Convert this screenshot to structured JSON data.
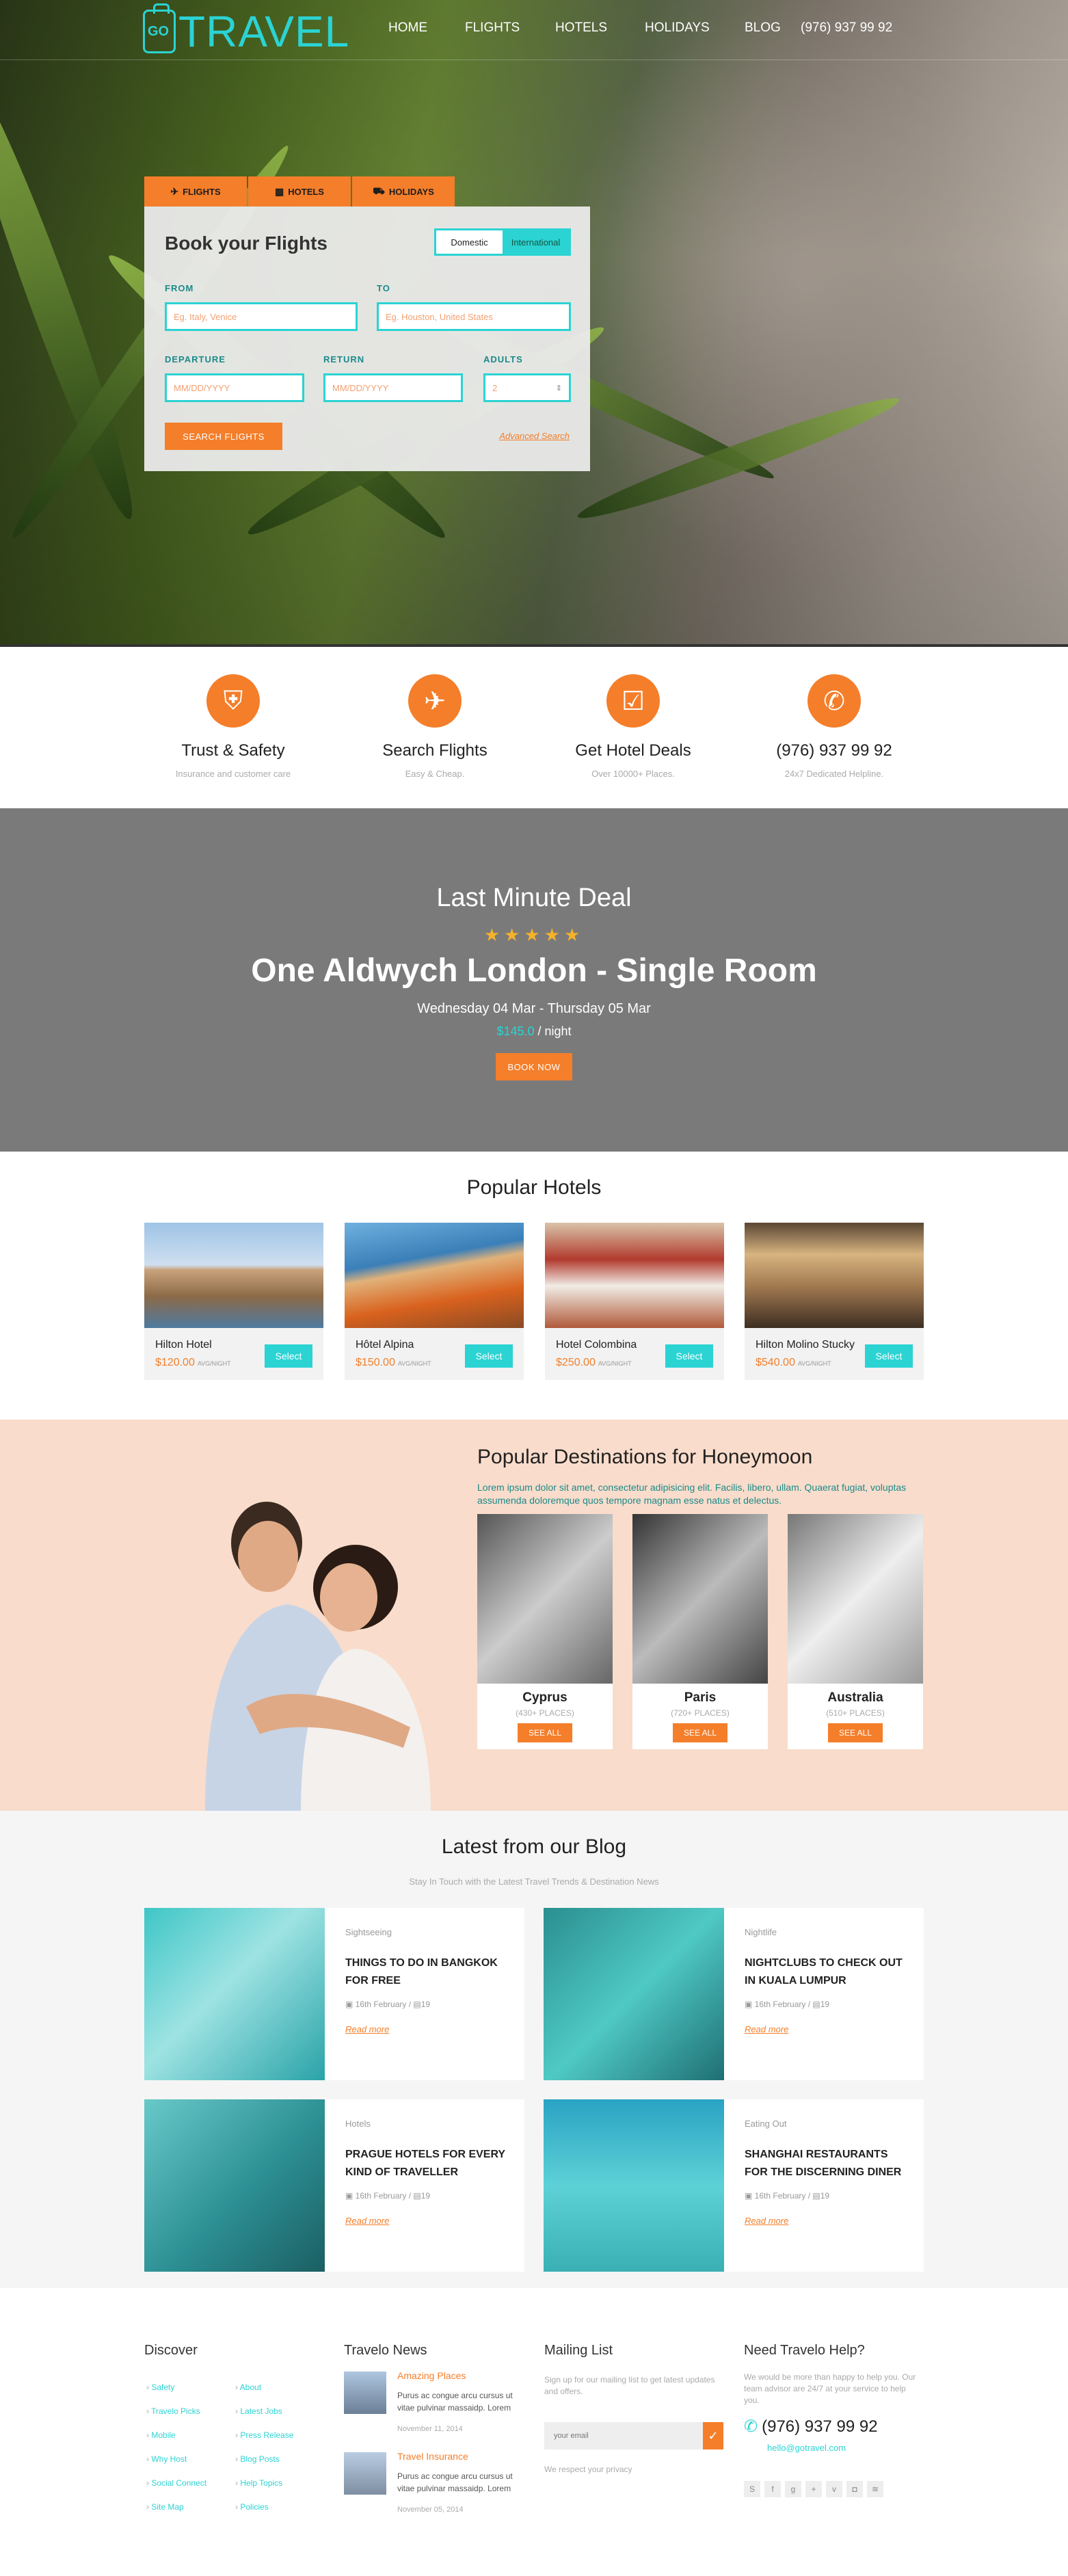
{
  "brand": {
    "logo_badge": "GO",
    "logo_text": "TRAVEL"
  },
  "nav": {
    "items": [
      "HOME",
      "FLIGHTS",
      "HOTELS",
      "HOLIDAYS",
      "BLOG",
      "(976) 937 99 92"
    ]
  },
  "search": {
    "tabs": [
      {
        "label": "FLIGHTS",
        "icon": "airplane-icon"
      },
      {
        "label": "HOTELS",
        "icon": "building-icon"
      },
      {
        "label": "HOLIDAYS",
        "icon": "suitcase-icon"
      }
    ],
    "title": "Book your Flights",
    "toggle": {
      "domestic": "Domestic",
      "international": "International"
    },
    "from_label": "FROM",
    "from_placeholder": "Eg. Italy, Venice",
    "to_label": "TO",
    "to_placeholder": "Eg. Houston, United States",
    "departure_label": "DEPARTURE",
    "departure_placeholder": "MM/DD/YYYY",
    "return_label": "RETURN",
    "return_placeholder": "MM/DD/YYYY",
    "adults_label": "ADULTS",
    "adults_value": "2",
    "submit": "SEARCH FLIGHTS",
    "advanced": "Advanced Search"
  },
  "features": [
    {
      "title": "Trust & Safety",
      "subtitle": "Insurance and customer care",
      "icon": "shield-icon"
    },
    {
      "title": "Search Flights",
      "subtitle": "Easy & Cheap.",
      "icon": "airplane-icon"
    },
    {
      "title": "Get Hotel Deals",
      "subtitle": "Over 10000+ Places.",
      "icon": "calendar-check-icon"
    },
    {
      "title": "(976) 937 99 92",
      "subtitle": "24x7 Dedicated Helpline.",
      "icon": "phone-icon"
    }
  ],
  "deal": {
    "heading": "Last Minute Deal",
    "stars": "★★★★★",
    "rating": 5,
    "title": "One Aldwych London - Single Room",
    "dates": "Wednesday 04 Mar - Thursday 05 Mar",
    "price": "$145.0",
    "per": " / night",
    "button": "BOOK NOW"
  },
  "hotels": {
    "title": "Popular Hotels",
    "per_night": "AVG/NIGHT",
    "select": "Select",
    "items": [
      {
        "name": "Hilton Hotel",
        "price": "$120.00"
      },
      {
        "name": "Hôtel Alpina",
        "price": "$150.00"
      },
      {
        "name": "Hotel Colombina",
        "price": "$250.00"
      },
      {
        "name": "Hilton Molino Stucky",
        "price": "$540.00"
      }
    ]
  },
  "honeymoon": {
    "title": "Popular Destinations for Honeymoon",
    "text": "Lorem ipsum dolor sit amet, consectetur adipisicing elit. Facilis, libero, ullam. Quaerat fugiat, voluptas assumenda doloremque quos tempore magnam esse natus et delectus.",
    "see_all": "SEE ALL",
    "items": [
      {
        "name": "Cyprus",
        "places": "(430+ PLACES)"
      },
      {
        "name": "Paris",
        "places": "(720+ PLACES)"
      },
      {
        "name": "Australia",
        "places": "(510+ PLACES)"
      }
    ]
  },
  "blog": {
    "title": "Latest from our Blog",
    "subtitle": "Stay In Touch with the Latest Travel Trends & Destination News",
    "read_more": "Read more",
    "posts": [
      {
        "category": "Sightseeing",
        "title": "THINGS TO DO IN BANGKOK FOR FREE",
        "date": "16th February",
        "comments": "19"
      },
      {
        "category": "Nightlife",
        "title": "NIGHTCLUBS TO CHECK OUT IN KUALA LUMPUR",
        "date": "16th February",
        "comments": "19"
      },
      {
        "category": "Hotels",
        "title": "PRAGUE HOTELS FOR EVERY KIND OF TRAVELLER",
        "date": "16th February",
        "comments": "19"
      },
      {
        "category": "Eating Out",
        "title": "SHANGHAI RESTAURANTS FOR THE DISCERNING DINER",
        "date": "16th February",
        "comments": "19"
      }
    ]
  },
  "footer": {
    "discover": {
      "title": "Discover",
      "col1": [
        "Safety",
        "Travelo Picks",
        "Mobile",
        "Why Host",
        "Social Connect",
        "Site Map"
      ],
      "col2": [
        "About",
        "Latest Jobs",
        "Press Release",
        "Blog Posts",
        "Help Topics",
        "Policies"
      ]
    },
    "news": {
      "title": "Travelo News",
      "items": [
        {
          "title": "Amazing Places",
          "body": "Purus ac congue arcu cursus ut vitae pulvinar massaidp. Lorem",
          "date": "November 11, 2014"
        },
        {
          "title": "Travel Insurance",
          "body": "Purus ac congue arcu cursus ut vitae pulvinar massaidp. Lorem",
          "date": "November 05, 2014"
        }
      ]
    },
    "mailing": {
      "title": "Mailing List",
      "desc": "Sign up for our mailing list to get latest updates and offers.",
      "placeholder": "your email",
      "note": "We respect your privacy"
    },
    "help": {
      "title": "Need Travelo Help?",
      "desc": "We would be more than happy to help you. Our team advisor are 24/7 at your service to help you.",
      "phone": "(976) 937 99 92",
      "email": "hello@gotravel.com",
      "socials": [
        "skype-icon",
        "facebook-icon",
        "googleplus-icon",
        "plus-icon",
        "vimeo-icon",
        "camera-icon",
        "rss-icon"
      ]
    }
  },
  "colors": {
    "accent_orange": "#f47e2a",
    "accent_cyan": "#2bd3d3",
    "deal_bg": "#7a7a7a",
    "honeymoon_bg": "#f9dccb"
  }
}
